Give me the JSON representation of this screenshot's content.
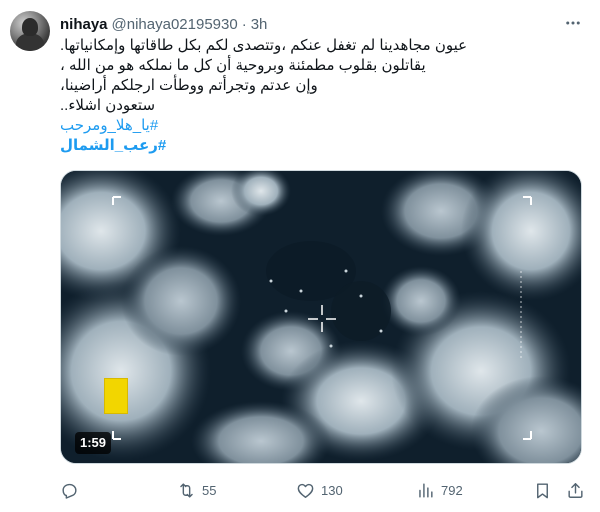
{
  "author": {
    "display_name": "nihaya",
    "handle": "@nihaya02195930",
    "separator": "·",
    "time": "3h"
  },
  "tweet": {
    "lines": [
      "عيون مجاهدينا لم تغفل عنكم ،وتتصدى لكم بكل طاقاتها وإمكانياتها.",
      "يقاتلون بقلوب مطمئنة وبروحية أن كل ما نملكه هو من الله ،",
      "وإن عدتم وتجرأتم ووطأت ارجلكم أراضينا،",
      "ستعودن اشلاء.."
    ],
    "hashtags": [
      "#يا_هلا_ومرحب",
      "#رعب_الشمال"
    ]
  },
  "media": {
    "type": "video",
    "duration": "1:59"
  },
  "actions": {
    "reply_count": "",
    "retweet_count": "55",
    "like_count": "130",
    "views_count": "792"
  },
  "icons": {
    "more": "more-icon",
    "reply": "reply-icon",
    "retweet": "retweet-icon",
    "like": "heart-icon",
    "views": "views-icon",
    "bookmark": "bookmark-icon",
    "share": "share-icon"
  },
  "colors": {
    "link": "#1d9bf0",
    "muted": "#536471",
    "text": "#0f1419"
  }
}
